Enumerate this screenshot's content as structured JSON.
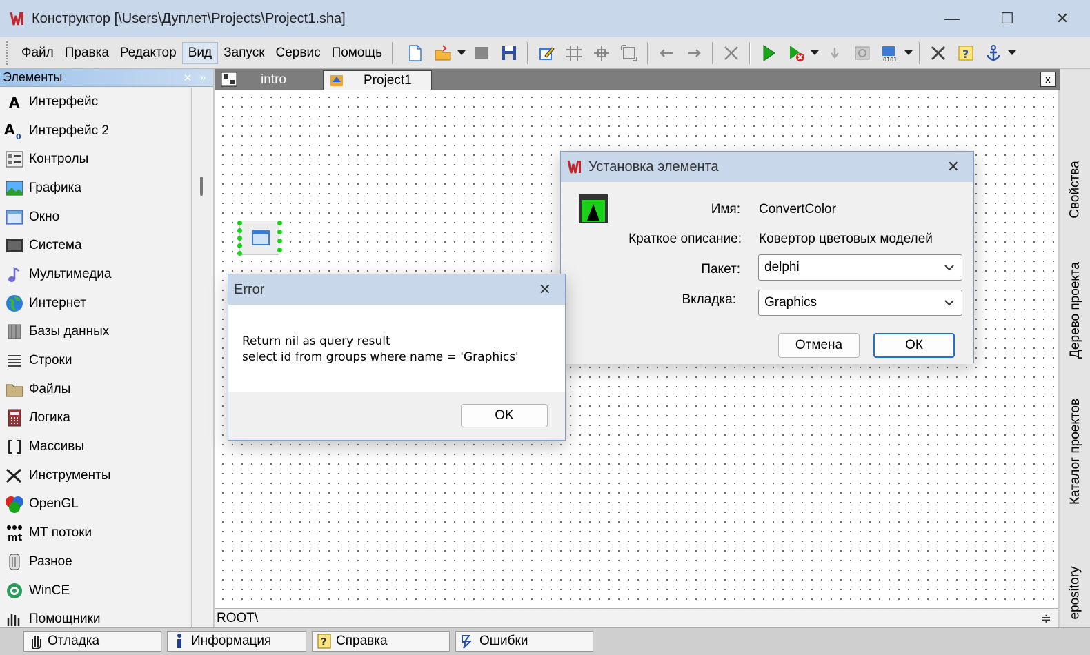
{
  "window": {
    "title": "Конструктор [\\Users\\Дуплет\\Projects\\Project1.sha]",
    "minimize": "—",
    "maximize": "☐",
    "close": "✕"
  },
  "menu": [
    "Файл",
    "Правка",
    "Редактор",
    "Вид",
    "Запуск",
    "Сервис",
    "Помощь"
  ],
  "elements_panel": {
    "title": "Элементы",
    "items": [
      {
        "label": "Интерфейс",
        "icon": "text-a-icon"
      },
      {
        "label": "Интерфейс 2",
        "icon": "text-a-sub-icon"
      },
      {
        "label": "Контролы",
        "icon": "controls-icon"
      },
      {
        "label": "Графика",
        "icon": "picture-icon"
      },
      {
        "label": "Окно",
        "icon": "window-icon"
      },
      {
        "label": "Система",
        "icon": "system-icon"
      },
      {
        "label": "Мультимедиа",
        "icon": "music-note-icon"
      },
      {
        "label": "Интернет",
        "icon": "globe-icon"
      },
      {
        "label": "Базы данных",
        "icon": "database-icon"
      },
      {
        "label": "Строки",
        "icon": "lines-icon"
      },
      {
        "label": "Файлы",
        "icon": "folder-icon"
      },
      {
        "label": "Логика",
        "icon": "calculator-icon"
      },
      {
        "label": "Массивы",
        "icon": "brackets-icon"
      },
      {
        "label": "Инструменты",
        "icon": "tools-icon"
      },
      {
        "label": "OpenGL",
        "icon": "opengl-icon"
      },
      {
        "label": "МТ потоки",
        "icon": "mt-icon"
      },
      {
        "label": "Разное",
        "icon": "misc-icon"
      },
      {
        "label": "WinCE",
        "icon": "wince-icon"
      },
      {
        "label": "Помощники",
        "icon": "helpers-icon"
      }
    ]
  },
  "tabs": [
    {
      "label": "intro",
      "active": false
    },
    {
      "label": "Project1",
      "active": true
    }
  ],
  "tab_close": "x",
  "status_path": "ROOT\\",
  "right_dock": [
    "Свойства",
    "Дерево проекта",
    "Каталог проектов",
    "epository"
  ],
  "bottom_tabs": [
    {
      "label": "Отладка",
      "icon": "hand-icon"
    },
    {
      "label": "Информация",
      "icon": "info-icon"
    },
    {
      "label": "Справка",
      "icon": "help-icon"
    },
    {
      "label": "Ошибки",
      "icon": "errors-icon"
    }
  ],
  "install_dialog": {
    "title": "Установка элемента",
    "name_label": "Имя:",
    "name_value": "ConvertColor",
    "desc_label": "Краткое описание:",
    "desc_value": "Ковертор цветовых моделей",
    "package_label": "Пакет:",
    "package_value": "delphi",
    "tab_label": "Вкладка:",
    "tab_value": "Graphics",
    "cancel": "Отмена",
    "ok": "ОК"
  },
  "error_dialog": {
    "title": "Error",
    "line1": "Return nil as query result",
    "line2": "select id from groups where name = 'Graphics'",
    "ok": "OK"
  }
}
